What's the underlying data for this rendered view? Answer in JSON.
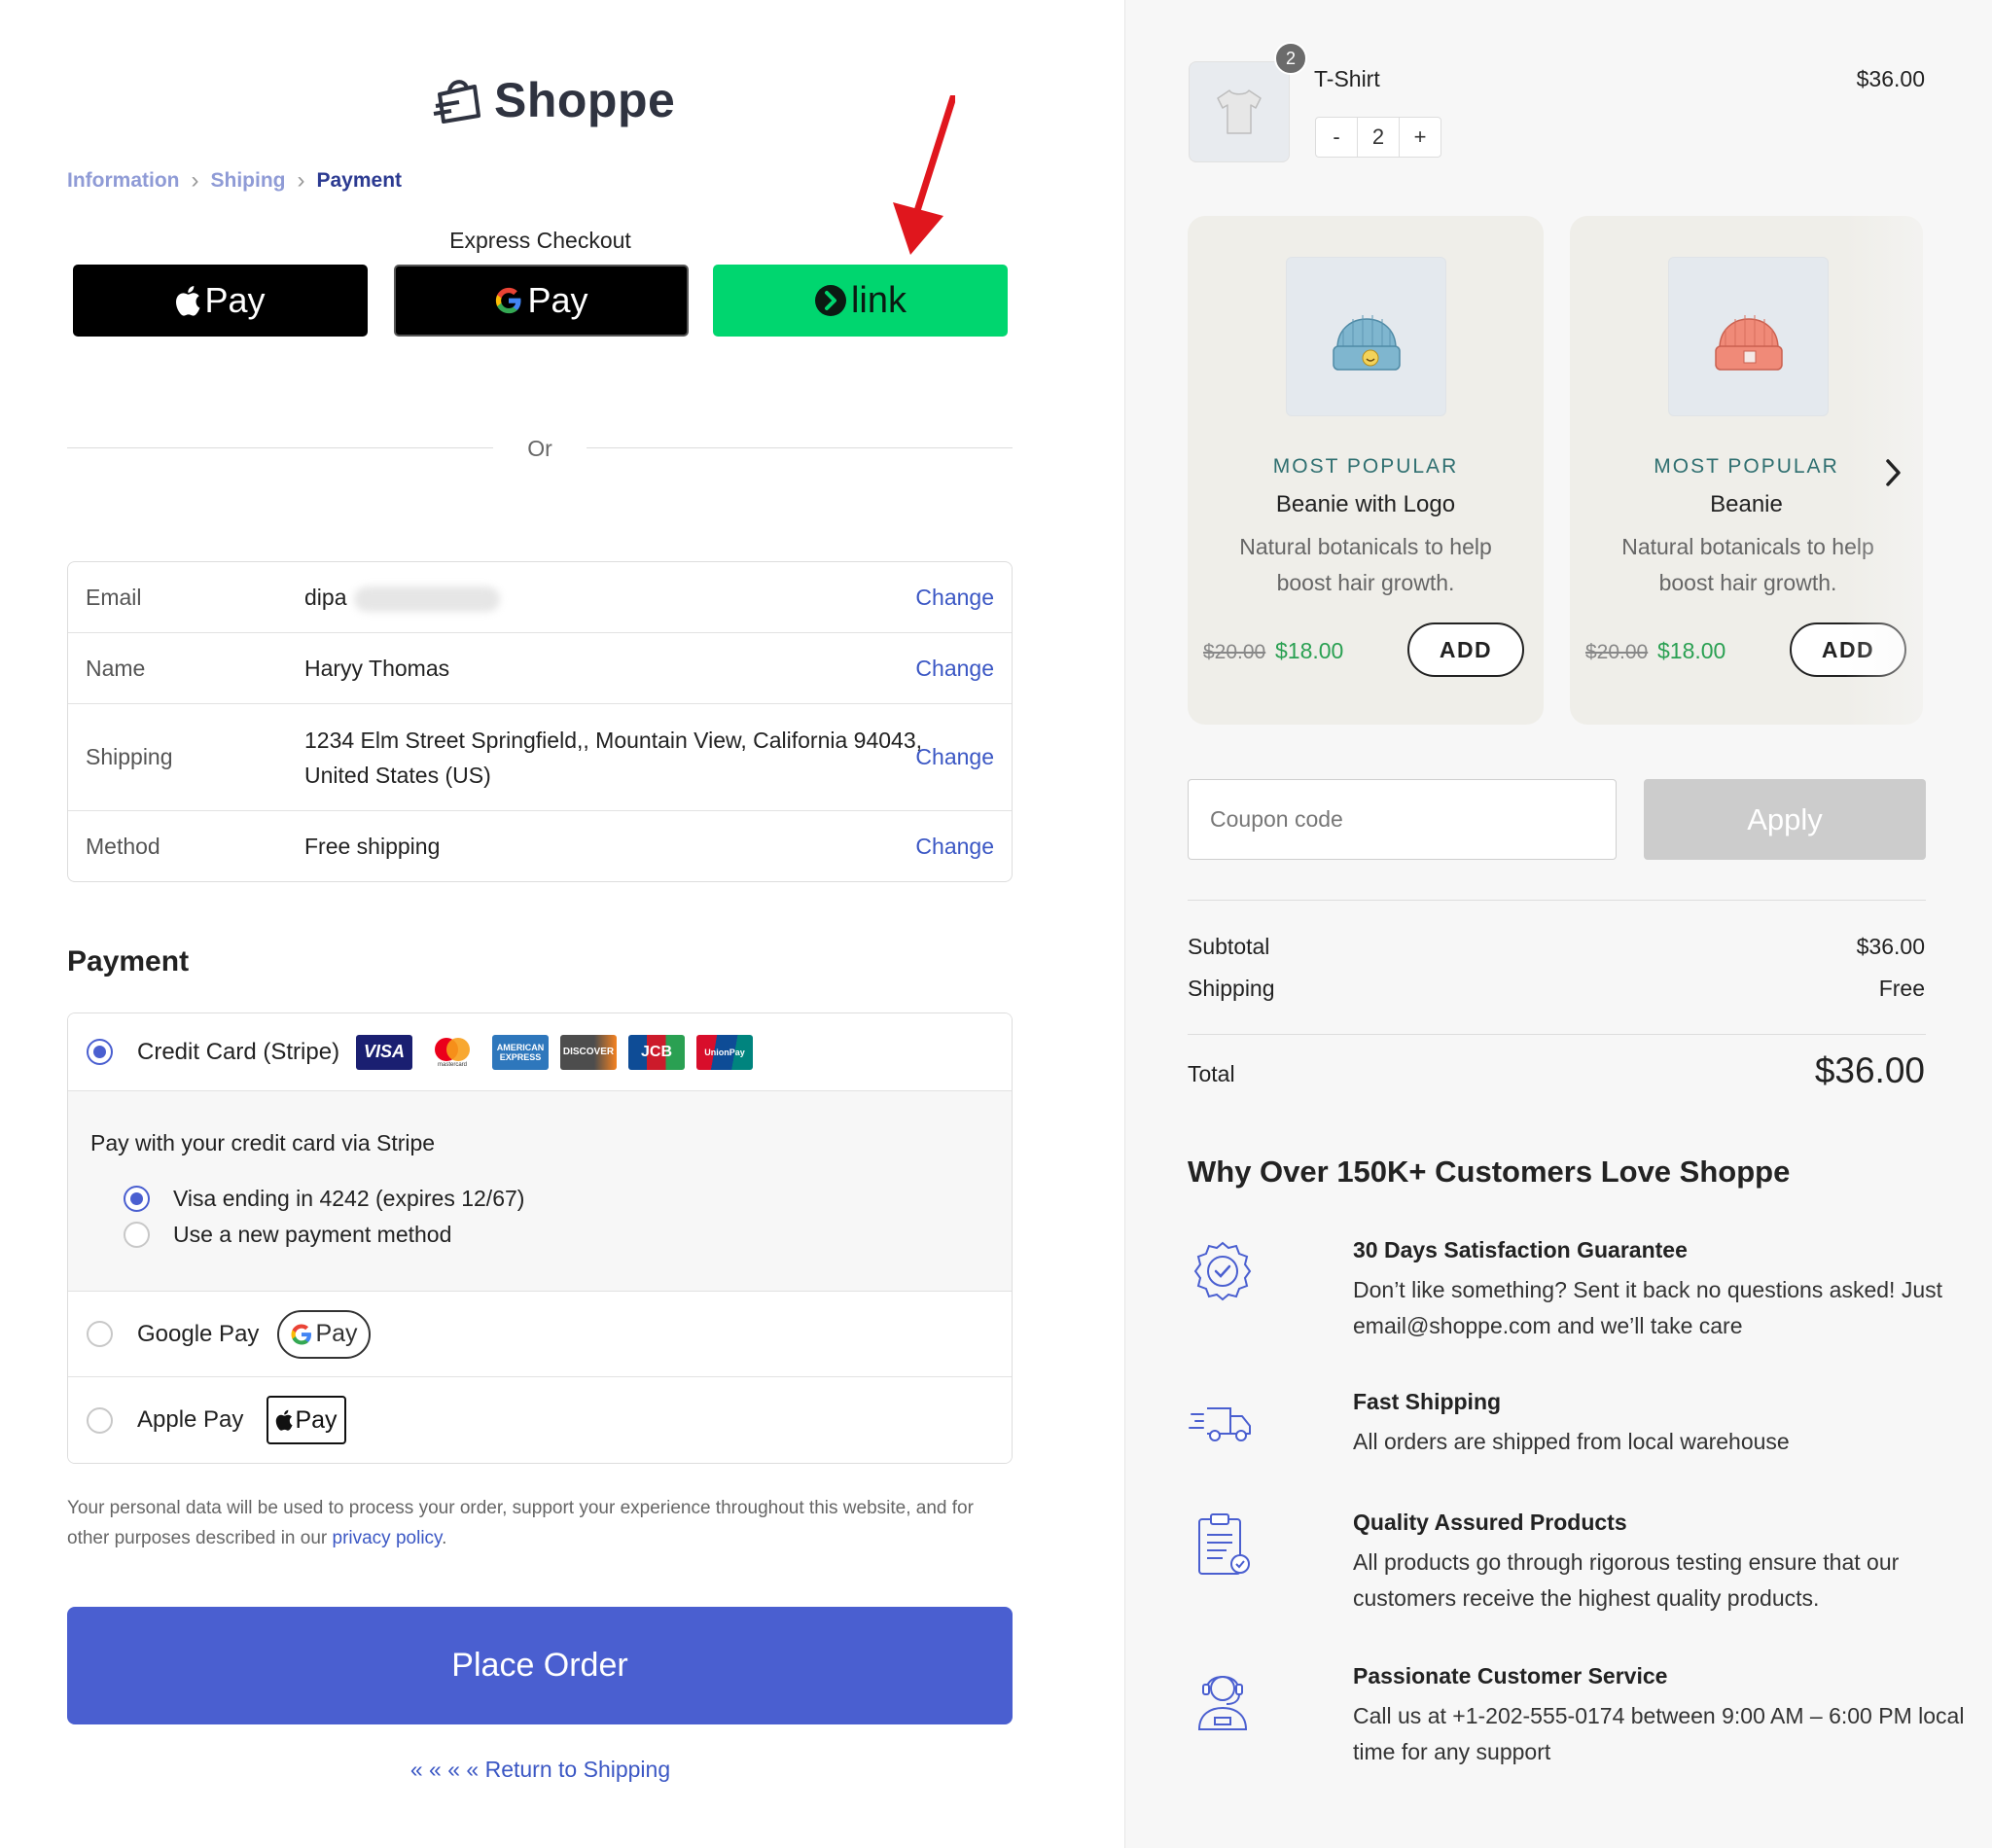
{
  "brand": {
    "name": "Shoppe"
  },
  "breadcrumb": {
    "step1": "Information",
    "step2": "Shiping",
    "step3": "Payment"
  },
  "express": {
    "label": "Express Checkout",
    "apple_text": "Pay",
    "gpay_text": "Pay",
    "link_text": "link"
  },
  "divider": {
    "text": "Or"
  },
  "summary_rows": [
    {
      "label": "Email",
      "value": "dipa",
      "action": "Change"
    },
    {
      "label": "Name",
      "value": "Haryy Thomas",
      "action": "Change"
    },
    {
      "label": "Shipping",
      "value": "1234 Elm Street Springfield,, Mountain View, California 94043, United States (US)",
      "action": "Change"
    },
    {
      "label": "Method",
      "value": "Free shipping",
      "action": "Change"
    }
  ],
  "payment": {
    "title": "Payment",
    "credit_card_label": "Credit Card (Stripe)",
    "card_brands": [
      "VISA",
      "mastercard",
      "AMERICAN EXPRESS",
      "DISCOVER",
      "JCB",
      "UnionPay"
    ],
    "stripe_desc": "Pay with your credit card via Stripe",
    "saved_card": "Visa ending in 4242 (expires 12/67)",
    "new_method": "Use a new payment method",
    "google_pay_label": "Google Pay",
    "google_pay_badge": "Pay",
    "apple_pay_label": "Apple Pay",
    "apple_pay_badge": "Pay"
  },
  "privacy": {
    "text": "Your personal data will be used to process your order, support your experience throughout this website, and for other purposes described in our ",
    "link": "privacy policy",
    "end": "."
  },
  "place_order": "Place Order",
  "return_link": "« « « « Return to Shipping",
  "cart": {
    "item_name": "T-Shirt",
    "item_price": "$36.00",
    "qty_badge": "2",
    "qty_minus": "-",
    "qty_value": "2",
    "qty_plus": "+"
  },
  "recommendations": [
    {
      "tag": "MOST POPULAR",
      "name": "Beanie with Logo",
      "desc": "Natural botanicals to help boost hair growth.",
      "old_price": "$20.00",
      "price": "$18.00",
      "add": "ADD",
      "color": "#7fb6cf"
    },
    {
      "tag": "MOST POPULAR",
      "name": "Beanie",
      "desc": "Natural botanicals to help boost hair growth.",
      "old_price": "$20.00",
      "price": "$18.00",
      "add": "ADD",
      "color": "#f08a78"
    }
  ],
  "coupon": {
    "placeholder": "Coupon code",
    "apply": "Apply"
  },
  "totals": {
    "subtotal_label": "Subtotal",
    "subtotal_value": "$36.00",
    "shipping_label": "Shipping",
    "shipping_value": "Free",
    "total_label": "Total",
    "total_value": "$36.00"
  },
  "why": {
    "title": "Why Over 150K+ Customers Love Shoppe",
    "items": [
      {
        "title": "30 Days Satisfaction Guarantee",
        "text": "Don’t like something? Sent it back no questions asked! Just email@shoppe.com and we’ll take care",
        "icon": "guarantee-badge-icon"
      },
      {
        "title": "Fast Shipping",
        "text": "All orders are shipped from local warehouse",
        "icon": "truck-icon"
      },
      {
        "title": "Quality Assured Products",
        "text": "All products go through rigorous testing ensure that our customers receive the highest quality products.",
        "icon": "clipboard-check-icon"
      },
      {
        "title": "Passionate Customer Service",
        "text": "Call us at +1-202-555-0174 between 9:00 AM – 6:00 PM local time for any support",
        "icon": "support-agent-icon"
      }
    ]
  },
  "colors": {
    "accent": "#4a5fd0",
    "link_green": "#00d66f",
    "sale_green": "#2aa052",
    "annotation_red": "#e0161d"
  }
}
